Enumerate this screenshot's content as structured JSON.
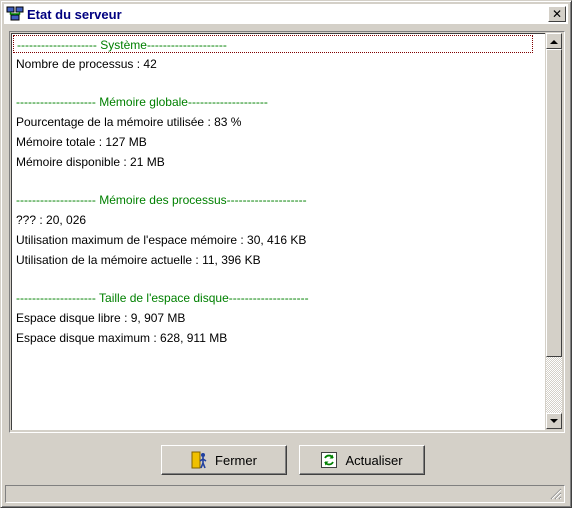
{
  "window": {
    "title": "Etat du serveur",
    "close_glyph": "✕"
  },
  "list": {
    "rows": [
      {
        "text": "-------------------- Système--------------------",
        "kind": "section"
      },
      {
        "text": "Nombre de processus : 42",
        "kind": "item"
      },
      {
        "text": "",
        "kind": "blank"
      },
      {
        "text": "-------------------- Mémoire globale--------------------",
        "kind": "section"
      },
      {
        "text": "Pourcentage de la mémoire utilisée : 83 %",
        "kind": "item"
      },
      {
        "text": "Mémoire totale : 127 MB",
        "kind": "item"
      },
      {
        "text": "Mémoire disponible : 21 MB",
        "kind": "item"
      },
      {
        "text": "",
        "kind": "blank"
      },
      {
        "text": "-------------------- Mémoire des processus--------------------",
        "kind": "section"
      },
      {
        "text": "??? : 20, 026",
        "kind": "item"
      },
      {
        "text": "Utilisation maximum de l'espace mémoire : 30, 416 KB",
        "kind": "item"
      },
      {
        "text": "Utilisation de la mémoire actuelle : 11, 396 KB",
        "kind": "item"
      },
      {
        "text": "",
        "kind": "blank"
      },
      {
        "text": "-------------------- Taille de l'espace disque--------------------",
        "kind": "section"
      },
      {
        "text": "Espace disque libre : 9, 907 MB",
        "kind": "item"
      },
      {
        "text": "Espace disque maximum : 628, 911 MB",
        "kind": "item"
      }
    ]
  },
  "buttons": {
    "close_label": "Fermer",
    "refresh_label": "Actualiser"
  },
  "icons": {
    "app": "server-network-icon",
    "close": "close-icon",
    "scroll_up": "arrow-up-icon",
    "scroll_down": "arrow-down-icon",
    "fermer": "door-exit-icon",
    "actualiser": "refresh-icon",
    "grip": "resize-grip-icon"
  },
  "colors": {
    "title_text": "#000080",
    "section_text": "#008000",
    "item_text": "#000000",
    "chrome": "#d4d0c8"
  }
}
